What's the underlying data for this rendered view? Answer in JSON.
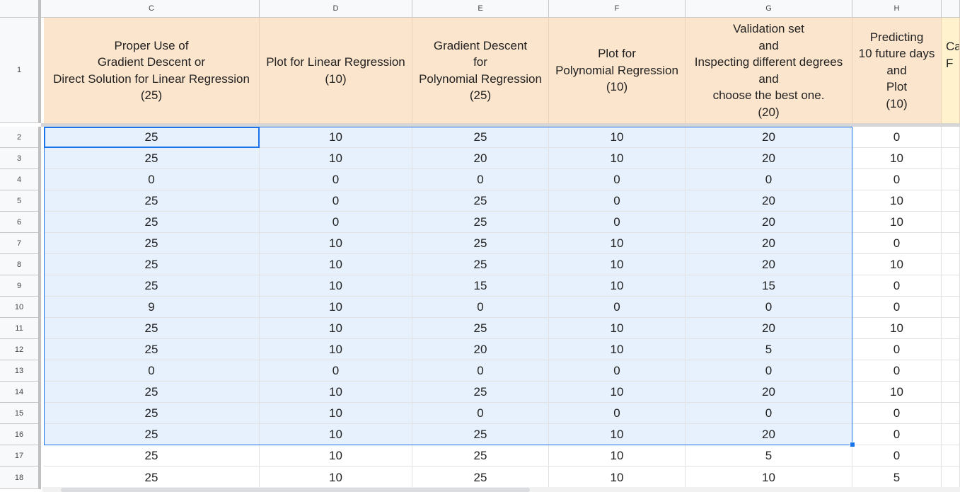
{
  "columns": [
    "C",
    "D",
    "E",
    "F",
    "G",
    "H",
    ""
  ],
  "header_row_number": "1",
  "header_texts": [
    "Proper Use of\nGradient Descent or\nDirect Solution for Linear Regression\n(25)",
    "Plot for Linear Regression\n(10)",
    "Gradient Descent\nfor\nPolynomial Regression\n(25)",
    "Plot for\nPolynomial Regression\n(10)",
    "Validation set\nand\nInspecting different degrees\nand\nchoose the best one.\n(20)",
    "Predicting\n10 future days\nand\nPlot\n(10)",
    "Ca\nF"
  ],
  "rows": [
    {
      "n": "2",
      "v": [
        "25",
        "10",
        "25",
        "10",
        "20",
        "0"
      ]
    },
    {
      "n": "3",
      "v": [
        "25",
        "10",
        "20",
        "10",
        "20",
        "10"
      ]
    },
    {
      "n": "4",
      "v": [
        "0",
        "0",
        "0",
        "0",
        "0",
        "0"
      ]
    },
    {
      "n": "5",
      "v": [
        "25",
        "0",
        "25",
        "0",
        "20",
        "10"
      ]
    },
    {
      "n": "6",
      "v": [
        "25",
        "0",
        "25",
        "0",
        "20",
        "10"
      ]
    },
    {
      "n": "7",
      "v": [
        "25",
        "10",
        "25",
        "10",
        "20",
        "0"
      ]
    },
    {
      "n": "8",
      "v": [
        "25",
        "10",
        "25",
        "10",
        "20",
        "10"
      ]
    },
    {
      "n": "9",
      "v": [
        "25",
        "10",
        "15",
        "10",
        "15",
        "0"
      ]
    },
    {
      "n": "10",
      "v": [
        "9",
        "10",
        "0",
        "0",
        "0",
        "0"
      ]
    },
    {
      "n": "11",
      "v": [
        "25",
        "10",
        "25",
        "10",
        "20",
        "10"
      ]
    },
    {
      "n": "12",
      "v": [
        "25",
        "10",
        "20",
        "10",
        "5",
        "0"
      ]
    },
    {
      "n": "13",
      "v": [
        "0",
        "0",
        "0",
        "0",
        "0",
        "0"
      ]
    },
    {
      "n": "14",
      "v": [
        "25",
        "10",
        "25",
        "10",
        "20",
        "10"
      ]
    },
    {
      "n": "15",
      "v": [
        "25",
        "10",
        "0",
        "0",
        "0",
        "0"
      ]
    },
    {
      "n": "16",
      "v": [
        "25",
        "10",
        "25",
        "10",
        "20",
        "0"
      ]
    },
    {
      "n": "17",
      "v": [
        "25",
        "10",
        "25",
        "10",
        "5",
        "0"
      ]
    },
    {
      "n": "18",
      "v": [
        "25",
        "10",
        "25",
        "10",
        "10",
        "5"
      ]
    }
  ],
  "colors": {
    "header_fill": "#fce5cd",
    "selection_fill": "#e7f0fd",
    "selection_border": "#1a73e8"
  },
  "icons": {
    "expand": "expand-triangle-icon"
  }
}
